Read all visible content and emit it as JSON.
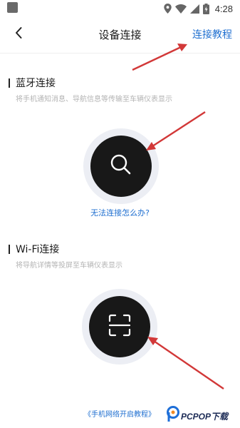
{
  "status_bar": {
    "time": "4:28",
    "icons": [
      "app-icon",
      "location-icon",
      "wifi-icon",
      "signal-icon",
      "battery-icon"
    ]
  },
  "nav": {
    "back_icon": "chevron-left-icon",
    "title": "设备连接",
    "tutorial_link": "连接教程",
    "link_color": "#1f6fd0"
  },
  "bluetooth": {
    "title": "蓝牙连接",
    "description": "将手机通知消息、导航信息等传输至车辆仪表显示",
    "button_icon": "search-icon",
    "help_link": "无法连接怎么办?"
  },
  "wifi": {
    "title": "Wi-Fi连接",
    "description": "将导航详情等投屏至车辆仪表显示",
    "button_icon": "scan-icon",
    "bottom_link": "《手机网络开启教程》"
  },
  "watermark": {
    "text": "PCPOP下载",
    "icon": "pcpop-logo-icon"
  },
  "annotation_color": "#d23838"
}
